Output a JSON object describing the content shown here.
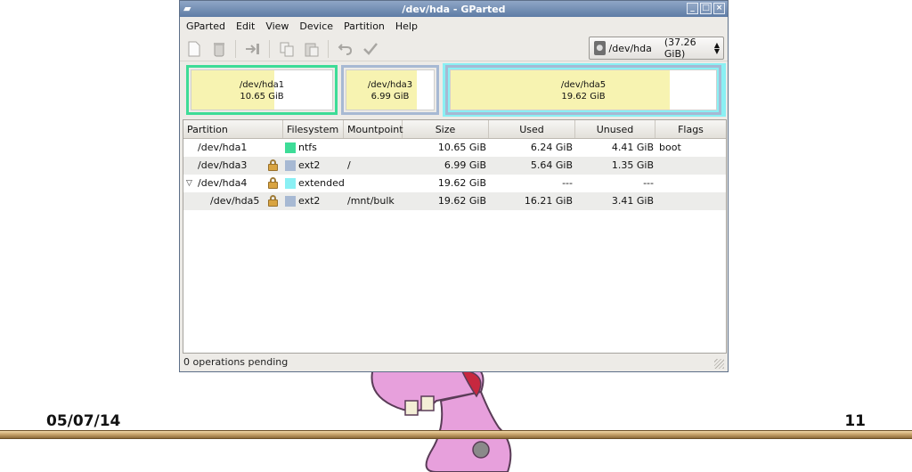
{
  "window": {
    "title": "/dev/hda - GParted"
  },
  "menu": [
    "GParted",
    "Edit",
    "View",
    "Device",
    "Partition",
    "Help"
  ],
  "toolbar": {
    "icons": [
      "new-icon",
      "delete-icon",
      "resize-move-icon",
      "copy-icon",
      "paste-icon",
      "undo-icon",
      "apply-icon"
    ]
  },
  "device": {
    "name": "/dev/hda",
    "size": "(37.26 GiB)"
  },
  "visual": {
    "hda1": {
      "name": "/dev/hda1",
      "size": "10.65 GiB",
      "used_fraction": 0.586,
      "border": "#3ddc97"
    },
    "hda3": {
      "name": "/dev/hda3",
      "size": "6.99 GiB",
      "used_fraction": 0.807,
      "border": "#a7b9d3"
    },
    "hda5": {
      "name": "/dev/hda5",
      "size": "19.62 GiB",
      "used_fraction": 0.826,
      "border": "#a7b9d3"
    },
    "extended_color": "#8af0f4",
    "used_color": "#f7f3b1"
  },
  "table": {
    "headers": [
      "Partition",
      "Filesystem",
      "Mountpoint",
      "Size",
      "Used",
      "Unused",
      "Flags"
    ],
    "rows": [
      {
        "partition": "/dev/hda1",
        "locked": false,
        "expander": false,
        "filesystem": "ntfs",
        "fs_color": "#3ddc97",
        "mountpoint": "",
        "size": "10.65 GiB",
        "used": "6.24 GiB",
        "unused": "4.41 GiB",
        "flags": "boot"
      },
      {
        "partition": "/dev/hda3",
        "locked": true,
        "expander": false,
        "filesystem": "ext2",
        "fs_color": "#a7b9d3",
        "mountpoint": "/",
        "size": "6.99 GiB",
        "used": "5.64 GiB",
        "unused": "1.35 GiB",
        "flags": ""
      },
      {
        "partition": "/dev/hda4",
        "locked": true,
        "expander": true,
        "filesystem": "extended",
        "fs_color": "#8af0f4",
        "mountpoint": "",
        "size": "19.62 GiB",
        "used": "---",
        "unused": "---",
        "flags": ""
      },
      {
        "partition": "/dev/hda5",
        "locked": true,
        "expander": false,
        "filesystem": "ext2",
        "fs_color": "#a7b9d3",
        "mountpoint": "/mnt/bulk",
        "size": "19.62 GiB",
        "used": "16.21 GiB",
        "unused": "3.41 GiB",
        "flags": ""
      }
    ]
  },
  "status": {
    "text": "0 operations pending"
  },
  "slide": {
    "date": "05/07/14",
    "page": "11"
  }
}
